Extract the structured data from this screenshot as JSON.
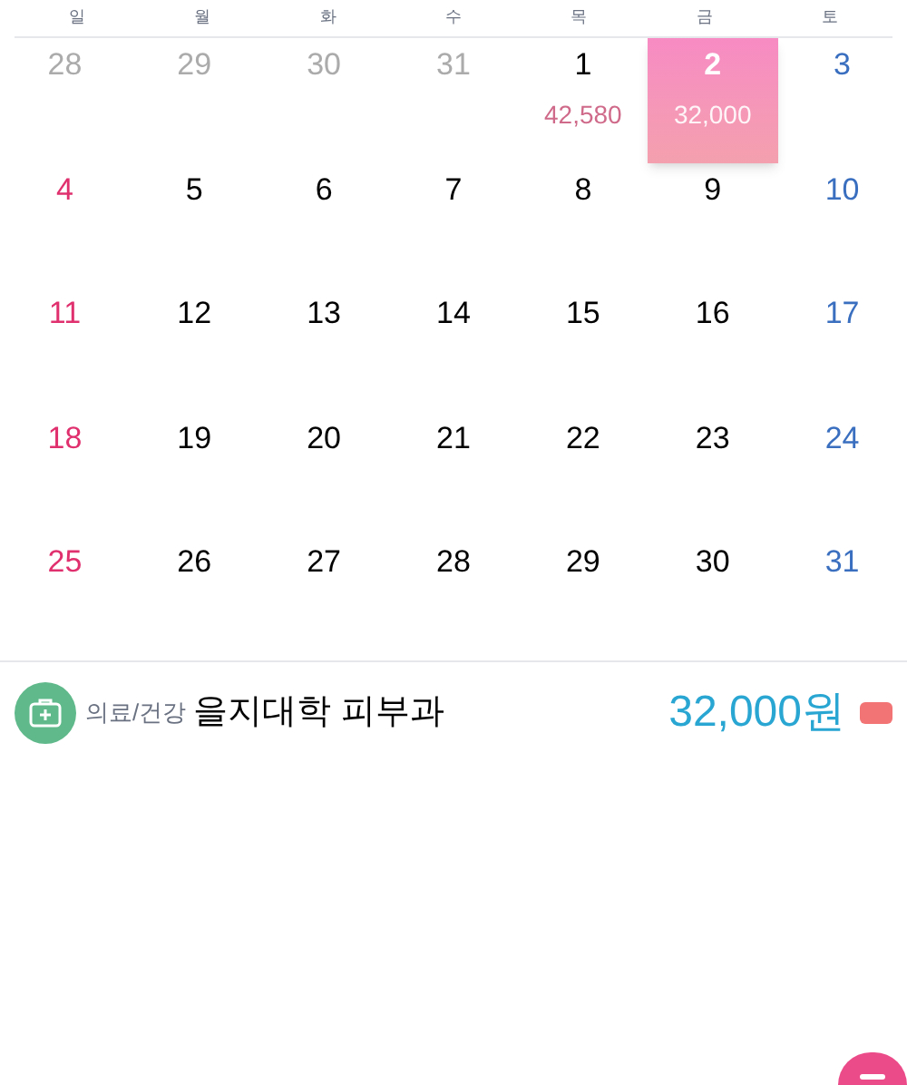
{
  "weekdays": [
    "일",
    "월",
    "화",
    "수",
    "목",
    "금",
    "토"
  ],
  "weeks": [
    [
      {
        "day": "28",
        "muted": true
      },
      {
        "day": "29",
        "muted": true
      },
      {
        "day": "30",
        "muted": true
      },
      {
        "day": "31",
        "muted": true
      },
      {
        "day": "1",
        "muted": false,
        "amount": "42,580"
      },
      {
        "day": "2",
        "muted": false,
        "selected": true,
        "amount": "32,000"
      },
      {
        "day": "3",
        "muted": false
      }
    ],
    [
      {
        "day": "4",
        "muted": false
      },
      {
        "day": "5",
        "muted": false
      },
      {
        "day": "6",
        "muted": false
      },
      {
        "day": "7",
        "muted": false
      },
      {
        "day": "8",
        "muted": false
      },
      {
        "day": "9",
        "muted": false
      },
      {
        "day": "10",
        "muted": false
      }
    ],
    [
      {
        "day": "11",
        "muted": false
      },
      {
        "day": "12",
        "muted": false
      },
      {
        "day": "13",
        "muted": false
      },
      {
        "day": "14",
        "muted": false
      },
      {
        "day": "15",
        "muted": false
      },
      {
        "day": "16",
        "muted": false
      },
      {
        "day": "17",
        "muted": false
      }
    ],
    [
      {
        "day": "18",
        "muted": false
      },
      {
        "day": "19",
        "muted": false
      },
      {
        "day": "20",
        "muted": false
      },
      {
        "day": "21",
        "muted": false
      },
      {
        "day": "22",
        "muted": false
      },
      {
        "day": "23",
        "muted": false
      },
      {
        "day": "24",
        "muted": false
      }
    ],
    [
      {
        "day": "25",
        "muted": false
      },
      {
        "day": "26",
        "muted": false
      },
      {
        "day": "27",
        "muted": false
      },
      {
        "day": "28",
        "muted": false
      },
      {
        "day": "29",
        "muted": false
      },
      {
        "day": "30",
        "muted": false
      },
      {
        "day": "31",
        "muted": false
      }
    ]
  ],
  "transactions": [
    {
      "category": "의료/건강",
      "merchant": "을지대학 피부과",
      "amount": "32,000원"
    }
  ]
}
